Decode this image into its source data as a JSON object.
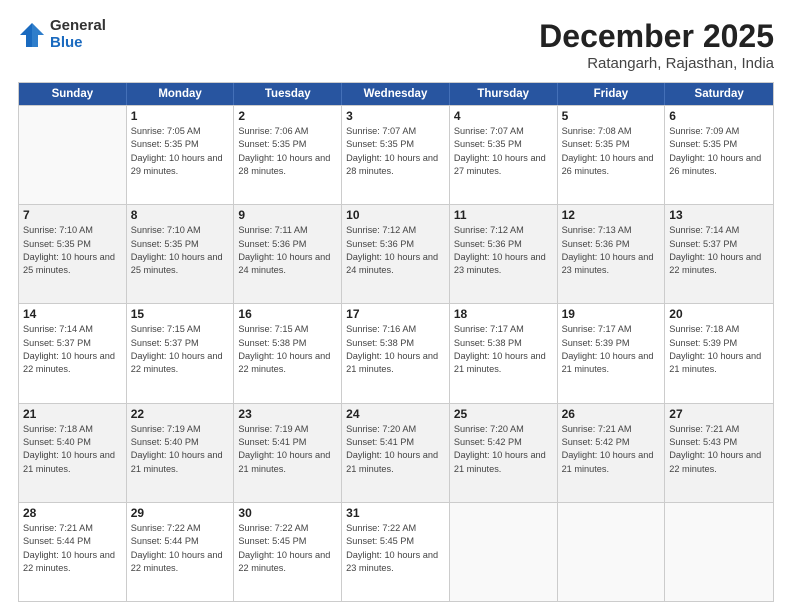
{
  "header": {
    "logo_general": "General",
    "logo_blue": "Blue",
    "month": "December 2025",
    "location": "Ratangarh, Rajasthan, India"
  },
  "days_of_week": [
    "Sunday",
    "Monday",
    "Tuesday",
    "Wednesday",
    "Thursday",
    "Friday",
    "Saturday"
  ],
  "weeks": [
    [
      {
        "day": "",
        "sunrise": "",
        "sunset": "",
        "daylight": ""
      },
      {
        "day": "1",
        "sunrise": "Sunrise: 7:05 AM",
        "sunset": "Sunset: 5:35 PM",
        "daylight": "Daylight: 10 hours and 29 minutes."
      },
      {
        "day": "2",
        "sunrise": "Sunrise: 7:06 AM",
        "sunset": "Sunset: 5:35 PM",
        "daylight": "Daylight: 10 hours and 28 minutes."
      },
      {
        "day": "3",
        "sunrise": "Sunrise: 7:07 AM",
        "sunset": "Sunset: 5:35 PM",
        "daylight": "Daylight: 10 hours and 28 minutes."
      },
      {
        "day": "4",
        "sunrise": "Sunrise: 7:07 AM",
        "sunset": "Sunset: 5:35 PM",
        "daylight": "Daylight: 10 hours and 27 minutes."
      },
      {
        "day": "5",
        "sunrise": "Sunrise: 7:08 AM",
        "sunset": "Sunset: 5:35 PM",
        "daylight": "Daylight: 10 hours and 26 minutes."
      },
      {
        "day": "6",
        "sunrise": "Sunrise: 7:09 AM",
        "sunset": "Sunset: 5:35 PM",
        "daylight": "Daylight: 10 hours and 26 minutes."
      }
    ],
    [
      {
        "day": "7",
        "sunrise": "Sunrise: 7:10 AM",
        "sunset": "Sunset: 5:35 PM",
        "daylight": "Daylight: 10 hours and 25 minutes."
      },
      {
        "day": "8",
        "sunrise": "Sunrise: 7:10 AM",
        "sunset": "Sunset: 5:35 PM",
        "daylight": "Daylight: 10 hours and 25 minutes."
      },
      {
        "day": "9",
        "sunrise": "Sunrise: 7:11 AM",
        "sunset": "Sunset: 5:36 PM",
        "daylight": "Daylight: 10 hours and 24 minutes."
      },
      {
        "day": "10",
        "sunrise": "Sunrise: 7:12 AM",
        "sunset": "Sunset: 5:36 PM",
        "daylight": "Daylight: 10 hours and 24 minutes."
      },
      {
        "day": "11",
        "sunrise": "Sunrise: 7:12 AM",
        "sunset": "Sunset: 5:36 PM",
        "daylight": "Daylight: 10 hours and 23 minutes."
      },
      {
        "day": "12",
        "sunrise": "Sunrise: 7:13 AM",
        "sunset": "Sunset: 5:36 PM",
        "daylight": "Daylight: 10 hours and 23 minutes."
      },
      {
        "day": "13",
        "sunrise": "Sunrise: 7:14 AM",
        "sunset": "Sunset: 5:37 PM",
        "daylight": "Daylight: 10 hours and 22 minutes."
      }
    ],
    [
      {
        "day": "14",
        "sunrise": "Sunrise: 7:14 AM",
        "sunset": "Sunset: 5:37 PM",
        "daylight": "Daylight: 10 hours and 22 minutes."
      },
      {
        "day": "15",
        "sunrise": "Sunrise: 7:15 AM",
        "sunset": "Sunset: 5:37 PM",
        "daylight": "Daylight: 10 hours and 22 minutes."
      },
      {
        "day": "16",
        "sunrise": "Sunrise: 7:15 AM",
        "sunset": "Sunset: 5:38 PM",
        "daylight": "Daylight: 10 hours and 22 minutes."
      },
      {
        "day": "17",
        "sunrise": "Sunrise: 7:16 AM",
        "sunset": "Sunset: 5:38 PM",
        "daylight": "Daylight: 10 hours and 21 minutes."
      },
      {
        "day": "18",
        "sunrise": "Sunrise: 7:17 AM",
        "sunset": "Sunset: 5:38 PM",
        "daylight": "Daylight: 10 hours and 21 minutes."
      },
      {
        "day": "19",
        "sunrise": "Sunrise: 7:17 AM",
        "sunset": "Sunset: 5:39 PM",
        "daylight": "Daylight: 10 hours and 21 minutes."
      },
      {
        "day": "20",
        "sunrise": "Sunrise: 7:18 AM",
        "sunset": "Sunset: 5:39 PM",
        "daylight": "Daylight: 10 hours and 21 minutes."
      }
    ],
    [
      {
        "day": "21",
        "sunrise": "Sunrise: 7:18 AM",
        "sunset": "Sunset: 5:40 PM",
        "daylight": "Daylight: 10 hours and 21 minutes."
      },
      {
        "day": "22",
        "sunrise": "Sunrise: 7:19 AM",
        "sunset": "Sunset: 5:40 PM",
        "daylight": "Daylight: 10 hours and 21 minutes."
      },
      {
        "day": "23",
        "sunrise": "Sunrise: 7:19 AM",
        "sunset": "Sunset: 5:41 PM",
        "daylight": "Daylight: 10 hours and 21 minutes."
      },
      {
        "day": "24",
        "sunrise": "Sunrise: 7:20 AM",
        "sunset": "Sunset: 5:41 PM",
        "daylight": "Daylight: 10 hours and 21 minutes."
      },
      {
        "day": "25",
        "sunrise": "Sunrise: 7:20 AM",
        "sunset": "Sunset: 5:42 PM",
        "daylight": "Daylight: 10 hours and 21 minutes."
      },
      {
        "day": "26",
        "sunrise": "Sunrise: 7:21 AM",
        "sunset": "Sunset: 5:42 PM",
        "daylight": "Daylight: 10 hours and 21 minutes."
      },
      {
        "day": "27",
        "sunrise": "Sunrise: 7:21 AM",
        "sunset": "Sunset: 5:43 PM",
        "daylight": "Daylight: 10 hours and 22 minutes."
      }
    ],
    [
      {
        "day": "28",
        "sunrise": "Sunrise: 7:21 AM",
        "sunset": "Sunset: 5:44 PM",
        "daylight": "Daylight: 10 hours and 22 minutes."
      },
      {
        "day": "29",
        "sunrise": "Sunrise: 7:22 AM",
        "sunset": "Sunset: 5:44 PM",
        "daylight": "Daylight: 10 hours and 22 minutes."
      },
      {
        "day": "30",
        "sunrise": "Sunrise: 7:22 AM",
        "sunset": "Sunset: 5:45 PM",
        "daylight": "Daylight: 10 hours and 22 minutes."
      },
      {
        "day": "31",
        "sunrise": "Sunrise: 7:22 AM",
        "sunset": "Sunset: 5:45 PM",
        "daylight": "Daylight: 10 hours and 23 minutes."
      },
      {
        "day": "",
        "sunrise": "",
        "sunset": "",
        "daylight": ""
      },
      {
        "day": "",
        "sunrise": "",
        "sunset": "",
        "daylight": ""
      },
      {
        "day": "",
        "sunrise": "",
        "sunset": "",
        "daylight": ""
      }
    ]
  ]
}
